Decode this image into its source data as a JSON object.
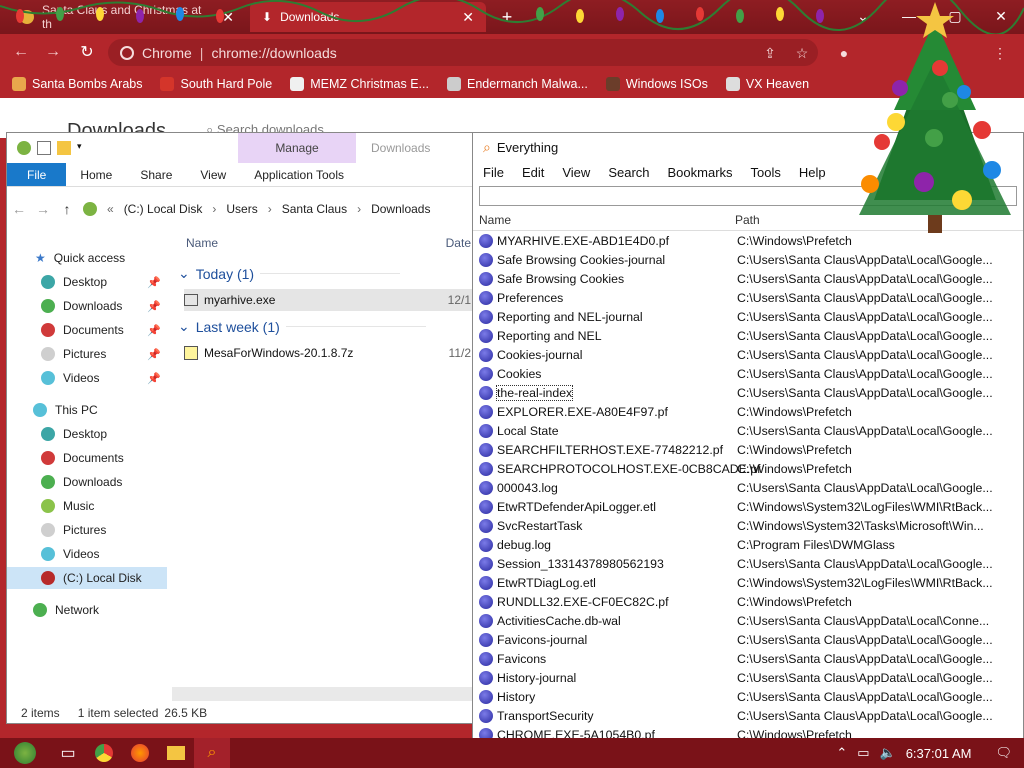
{
  "browser": {
    "tabs": [
      {
        "label": "Santa Claus and Christmas at th"
      },
      {
        "label": "Downloads"
      }
    ],
    "omnibox": {
      "origin": "Chrome",
      "url": "chrome://downloads"
    },
    "bookmarks": [
      {
        "label": "Santa Bombs Arabs",
        "color": "#e9a74c"
      },
      {
        "label": "South Hard Pole",
        "color": "#d4352a"
      },
      {
        "label": "MEMZ Christmas E...",
        "color": "#f0f0f0"
      },
      {
        "label": "Endermanch Malwa...",
        "color": "#cccccc"
      },
      {
        "label": "Windows ISOs",
        "color": "#6b3d2a"
      },
      {
        "label": "VX Heaven",
        "color": "#dddddd"
      }
    ],
    "page": {
      "title": "Downloads",
      "search_placeholder": "Search downloads"
    }
  },
  "explorer": {
    "contextual_tab": "Manage",
    "title_tab": "Downloads",
    "ribbon": [
      "File",
      "Home",
      "Share",
      "View",
      "Application Tools"
    ],
    "breadcrumb": [
      "(C:) Local Disk",
      "Users",
      "Santa Claus",
      "Downloads"
    ],
    "quick_access": "Quick access",
    "sidebar": [
      {
        "label": "Desktop",
        "color": "#3ca6a6",
        "pinned": true
      },
      {
        "label": "Downloads",
        "color": "#4caf50",
        "pinned": true
      },
      {
        "label": "Documents",
        "color": "#d03a3a",
        "pinned": true
      },
      {
        "label": "Pictures",
        "color": "#cfcfcf",
        "pinned": true
      },
      {
        "label": "Videos",
        "color": "#57c0d8",
        "pinned": true
      }
    ],
    "this_pc": "This PC",
    "pc_items": [
      {
        "label": "Desktop",
        "color": "#3ca6a6"
      },
      {
        "label": "Documents",
        "color": "#d03a3a"
      },
      {
        "label": "Downloads",
        "color": "#4caf50"
      },
      {
        "label": "Music",
        "color": "#8bc34a"
      },
      {
        "label": "Pictures",
        "color": "#cfcfcf"
      },
      {
        "label": "Videos",
        "color": "#57c0d8"
      },
      {
        "label": "(C:) Local Disk",
        "color": "#b72a2a"
      }
    ],
    "network": "Network",
    "columns": {
      "name": "Name",
      "date": "Date"
    },
    "groups": [
      {
        "label": "Today (1)",
        "file": "myarhive.exe",
        "date": "12/1"
      },
      {
        "label": "Last week (1)",
        "file": "MesaForWindows-20.1.8.7z",
        "date": "11/2"
      }
    ],
    "status": {
      "items": "2 items",
      "selected": "1 item selected",
      "size": "26.5 KB"
    }
  },
  "everything": {
    "title": "Everything",
    "menu": [
      "File",
      "Edit",
      "View",
      "Search",
      "Bookmarks",
      "Tools",
      "Help"
    ],
    "columns": {
      "name": "Name",
      "path": "Path"
    },
    "rows": [
      {
        "name": "MYARHIVE.EXE-ABD1E4D0.pf",
        "path": "C:\\Windows\\Prefetch"
      },
      {
        "name": "Safe Browsing Cookies-journal",
        "path": "C:\\Users\\Santa Claus\\AppData\\Local\\Google..."
      },
      {
        "name": "Safe Browsing Cookies",
        "path": "C:\\Users\\Santa Claus\\AppData\\Local\\Google..."
      },
      {
        "name": "Preferences",
        "path": "C:\\Users\\Santa Claus\\AppData\\Local\\Google..."
      },
      {
        "name": "Reporting and NEL-journal",
        "path": "C:\\Users\\Santa Claus\\AppData\\Local\\Google..."
      },
      {
        "name": "Reporting and NEL",
        "path": "C:\\Users\\Santa Claus\\AppData\\Local\\Google..."
      },
      {
        "name": "Cookies-journal",
        "path": "C:\\Users\\Santa Claus\\AppData\\Local\\Google..."
      },
      {
        "name": "Cookies",
        "path": "C:\\Users\\Santa Claus\\AppData\\Local\\Google..."
      },
      {
        "name": "the-real-index",
        "path": "C:\\Users\\Santa Claus\\AppData\\Local\\Google..."
      },
      {
        "name": "EXPLORER.EXE-A80E4F97.pf",
        "path": "C:\\Windows\\Prefetch"
      },
      {
        "name": "Local State",
        "path": "C:\\Users\\Santa Claus\\AppData\\Local\\Google..."
      },
      {
        "name": "SEARCHFILTERHOST.EXE-77482212.pf",
        "path": "C:\\Windows\\Prefetch"
      },
      {
        "name": "SEARCHPROTOCOLHOST.EXE-0CB8CADE.pf",
        "path": "C:\\Windows\\Prefetch"
      },
      {
        "name": "000043.log",
        "path": "C:\\Users\\Santa Claus\\AppData\\Local\\Google..."
      },
      {
        "name": "EtwRTDefenderApiLogger.etl",
        "path": "C:\\Windows\\System32\\LogFiles\\WMI\\RtBack..."
      },
      {
        "name": "SvcRestartTask",
        "path": "C:\\Windows\\System32\\Tasks\\Microsoft\\Win..."
      },
      {
        "name": "debug.log",
        "path": "C:\\Program Files\\DWMGlass"
      },
      {
        "name": "Session_13314378980562193",
        "path": "C:\\Users\\Santa Claus\\AppData\\Local\\Google..."
      },
      {
        "name": "EtwRTDiagLog.etl",
        "path": "C:\\Windows\\System32\\LogFiles\\WMI\\RtBack..."
      },
      {
        "name": "RUNDLL32.EXE-CF0EC82C.pf",
        "path": "C:\\Windows\\Prefetch"
      },
      {
        "name": "ActivitiesCache.db-wal",
        "path": "C:\\Users\\Santa Claus\\AppData\\Local\\Conne..."
      },
      {
        "name": "Favicons-journal",
        "path": "C:\\Users\\Santa Claus\\AppData\\Local\\Google..."
      },
      {
        "name": "Favicons",
        "path": "C:\\Users\\Santa Claus\\AppData\\Local\\Google..."
      },
      {
        "name": "History-journal",
        "path": "C:\\Users\\Santa Claus\\AppData\\Local\\Google..."
      },
      {
        "name": "History",
        "path": "C:\\Users\\Santa Claus\\AppData\\Local\\Google..."
      },
      {
        "name": "TransportSecurity",
        "path": "C:\\Users\\Santa Claus\\AppData\\Local\\Google..."
      },
      {
        "name": "CHROME.EXE-5A1054B0.pf",
        "path": "C:\\Windows\\Prefetch"
      }
    ],
    "focused_row": "the-real-index"
  },
  "taskbar": {
    "clock": "6:37:01 AM"
  },
  "colors": {
    "theme_red": "#b3262b",
    "taskbar": "#7a1218",
    "manage_tab": "#e8d4f6",
    "file_tab": "#1979ca"
  }
}
